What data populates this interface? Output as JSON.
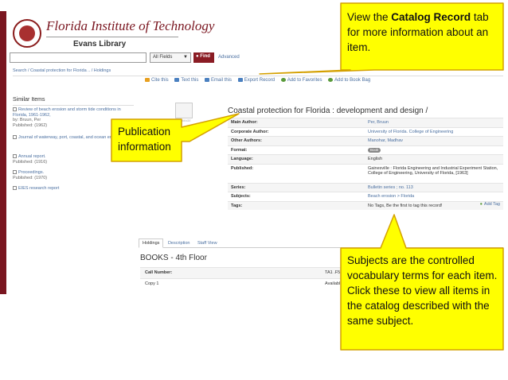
{
  "header": {
    "institution": "Florida Institute of Technology",
    "library": "Evans Library"
  },
  "search": {
    "input_value": "",
    "scope": "All Fields",
    "find_label": "Find",
    "advanced_label": "Advanced"
  },
  "breadcrumb": "Search  /  Coastal protection for Florida ..  /  Holdings",
  "toolbar": {
    "items": [
      {
        "label": "Cite this",
        "color": "#e8a020"
      },
      {
        "label": "Text this",
        "color": "#4a80c0"
      },
      {
        "label": "Email this",
        "color": "#4a80c0"
      },
      {
        "label": "Export Record",
        "color": "#4a80c0"
      },
      {
        "label": "Add to Favorites",
        "color": "#5a9a3a"
      },
      {
        "label": "Add to Book Bag",
        "color": "#5a9a3a"
      }
    ]
  },
  "sidebar": {
    "heading": "Similar Items",
    "items": [
      {
        "title": "Review of beach erosion and storm tide conditions in Florida, 1961-1962,",
        "byline": "by: Bruun, Per",
        "published": "Published: (1962)"
      },
      {
        "title": "Journal of waterway, port, coastal, and ocean engineering",
        "byline": "",
        "published": ""
      },
      {
        "title": "Annual report.",
        "byline": "",
        "published": "Published: (1916)"
      },
      {
        "title": "Proceedings.",
        "byline": "",
        "published": "Published: (1970)"
      },
      {
        "title": "EIES research report",
        "byline": "",
        "published": ""
      }
    ]
  },
  "record": {
    "title": "Coastal protection for Florida : development and design /",
    "thumb_caption": "NO IMAGE",
    "fields": [
      {
        "key": "Main Author:",
        "value": "Per, Bruun",
        "link": true
      },
      {
        "key": "Corporate Author:",
        "value": "University of Florida. College of Engineering",
        "link": true
      },
      {
        "key": "Other Authors:",
        "value": "Manohar, Madhav",
        "link": true
      },
      {
        "key": "Format:",
        "value": "Book",
        "link": false,
        "pill": true
      },
      {
        "key": "Language:",
        "value": "English",
        "link": false
      },
      {
        "key": "Published:",
        "value": "Gainesville : Florida Engineering and Industrial Experiment Station, College of Engineering, University of Florida, [1963]",
        "link": false
      },
      {
        "key": "Series:",
        "value": "Bulletin series ; no. 113",
        "link": true
      },
      {
        "key": "Subjects:",
        "value": "Beach erosion > Florida",
        "link": true
      },
      {
        "key": "Tags:",
        "value": "No Tags, Be the first to tag this record!",
        "link": false,
        "add": "Add Tag"
      }
    ]
  },
  "tabs": [
    {
      "label": "Holdings",
      "active": true
    },
    {
      "label": "Description",
      "active": false
    },
    {
      "label": "Staff View",
      "active": false
    }
  ],
  "holdings": {
    "location": "BOOKS - 4th Floor",
    "rows": [
      {
        "key": "Call Number:",
        "value": "TA1 .F5"
      },
      {
        "key": "Copy 1",
        "value": "Availabl"
      }
    ]
  },
  "callouts": {
    "catalog_record": {
      "pre": "View the ",
      "bold": "Catalog Record",
      "post": " tab for more information about an item."
    },
    "publication": {
      "text": "Publication information"
    },
    "subjects": {
      "text": "Subjects are the controlled vocabulary terms for each item. Click these to view all items in the catalog described with the same subject."
    },
    "fill": "#ffff00",
    "border": "#d4a000"
  }
}
